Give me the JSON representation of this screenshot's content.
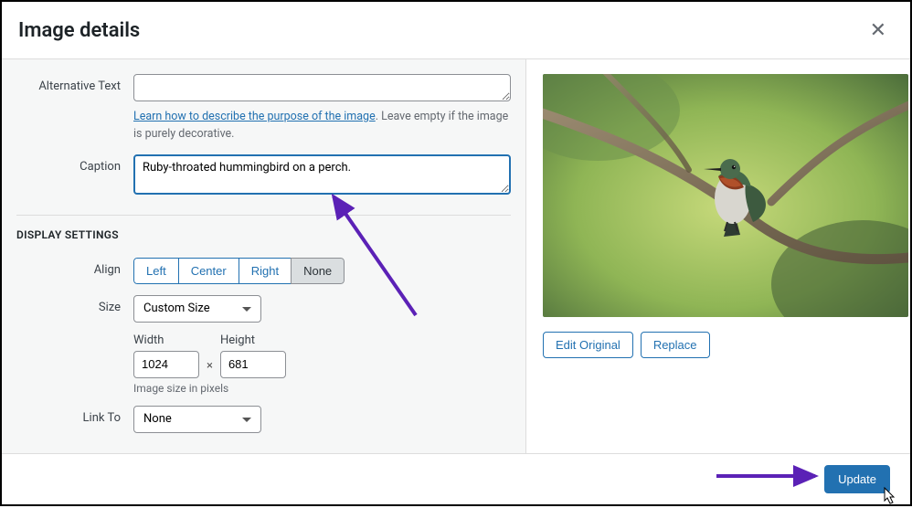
{
  "header": {
    "title": "Image details"
  },
  "left": {
    "alt_label": "Alternative Text",
    "alt_value": "",
    "alt_hint_link": "Learn how to describe the purpose of the image",
    "alt_hint_rest": ". Leave empty if the image is purely decorative.",
    "caption_label": "Caption",
    "caption_value": "Ruby-throated hummingbird on a perch.",
    "display_title": "DISPLAY SETTINGS",
    "align_label": "Align",
    "align_options": [
      "Left",
      "Center",
      "Right",
      "None"
    ],
    "align_selected": "None",
    "size_label": "Size",
    "size_value": "Custom Size",
    "width_label": "Width",
    "width_value": "1024",
    "height_label": "Height",
    "height_value": "681",
    "by_symbol": "×",
    "size_hint": "Image size in pixels",
    "linkto_label": "Link To",
    "linkto_value": "None"
  },
  "right": {
    "edit_label": "Edit Original",
    "replace_label": "Replace"
  },
  "footer": {
    "update_label": "Update"
  }
}
